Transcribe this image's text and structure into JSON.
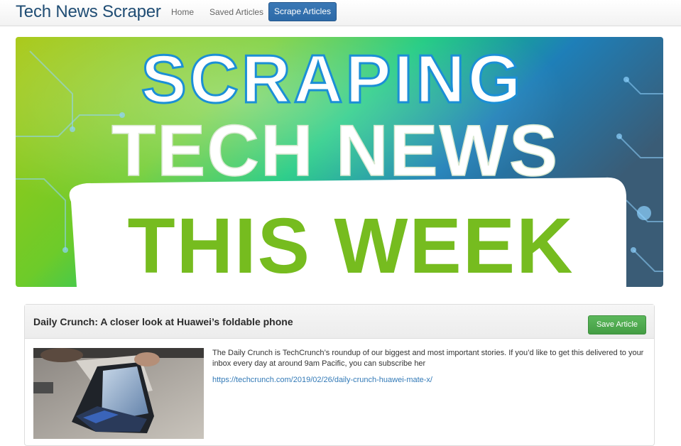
{
  "navbar": {
    "brand": "Tech News Scraper",
    "links": [
      {
        "label": "Home"
      },
      {
        "label": "Saved Articles"
      }
    ],
    "active_button": "Scrape Articles"
  },
  "hero": {
    "line1": "SCRAPING",
    "line2": "TECH NEWS",
    "line3": "THIS WEEK"
  },
  "article": {
    "title": "Daily Crunch: A closer look at Huawei’s foldable phone",
    "save_label": "Save Article",
    "summary": "The Daily Crunch is TechCrunch’s roundup of our biggest and most important stories. If you’d like to get this delivered to your inbox every day at around 9am Pacific, you can subscribe her",
    "link": "https://techcrunch.com/2019/02/26/daily-crunch-huawei-mate-x/"
  },
  "colors": {
    "brand": "#204d74",
    "primary": "#2d6aa8",
    "success": "#449d44",
    "link": "#337ab7",
    "hero_green": "#76bc1f"
  }
}
